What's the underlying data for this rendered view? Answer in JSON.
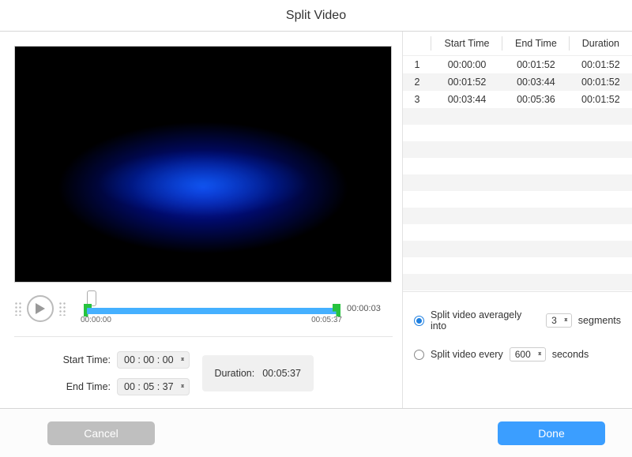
{
  "title": "Split Video",
  "timeline": {
    "current": "00:00:03",
    "start": "00:00:00",
    "end": "00:05:37"
  },
  "fields": {
    "start_label": "Start Time:",
    "end_label": "End Time:",
    "start_value": "00 : 00 : 00",
    "end_value": "00 : 05 : 37",
    "duration_label": "Duration:",
    "duration_value": "00:05:37"
  },
  "table": {
    "headers": {
      "index": "",
      "start": "Start Time",
      "end": "End Time",
      "duration": "Duration"
    },
    "rows": [
      {
        "idx": "1",
        "start": "00:00:00",
        "end": "00:01:52",
        "duration": "00:01:52"
      },
      {
        "idx": "2",
        "start": "00:01:52",
        "end": "00:03:44",
        "duration": "00:01:52"
      },
      {
        "idx": "3",
        "start": "00:03:44",
        "end": "00:05:36",
        "duration": "00:01:52"
      }
    ]
  },
  "options": {
    "avg_label_pre": "Split video averagely into",
    "avg_value": "3",
    "avg_label_post": "segments",
    "every_label_pre": "Split video every",
    "every_value": "600",
    "every_label_post": "seconds",
    "selected": "average"
  },
  "buttons": {
    "cancel": "Cancel",
    "done": "Done"
  }
}
